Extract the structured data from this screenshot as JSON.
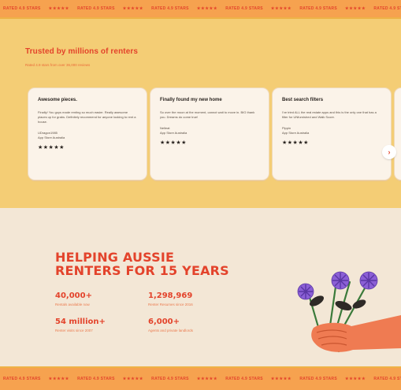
{
  "ticker": {
    "text": "RATED 4.9 STARS",
    "stars": "★★★★★"
  },
  "reviews": {
    "title": "Trusted by millions of renters",
    "subtitle": "Rated 4.9 stars from over 36,000 reviews",
    "cards": [
      {
        "title": "Awesome pieces.",
        "body": "Finally! You guys made renting so much easier. Really awesome places up for grabs. Definitely recommend for anyone looking to rent a house.",
        "author": "UDragon1985",
        "source": "App Store Australia",
        "stars": "★★★★★"
      },
      {
        "title": "Finally found my new home",
        "body": "So over the moon at the moment, cannot wait to move in. BIG thank you. Dreams do come true!",
        "author": "Nelleat",
        "source": "App Store Australia",
        "stars": "★★★★★"
      },
      {
        "title": "Best search filters",
        "body": "I've tried ALL the real estate apps and this is the only one that has a filter for UNfurnished and Walk Score.",
        "author": "Pippin",
        "source": "App Store Australia",
        "stars": "★★★★★"
      }
    ],
    "next_label": "›"
  },
  "stats": {
    "headline_line1": "HELPING AUSSIE",
    "headline_line2": "RENTERS FOR 15 YEARS",
    "items": [
      {
        "value": "40,000+",
        "label": "Rentals available now"
      },
      {
        "value": "1,298,969",
        "label": "Renter Resumes since 2016"
      },
      {
        "value": "54 million+",
        "label": "Renter visits since 2007"
      },
      {
        "value": "6,000+",
        "label": "Agents and private landlords"
      }
    ]
  },
  "colors": {
    "accent": "#e3432b",
    "yellow": "#f4cd75",
    "cream": "#f3e7d6",
    "orange": "#f6a24f"
  }
}
